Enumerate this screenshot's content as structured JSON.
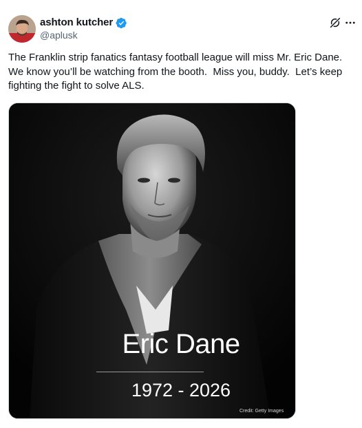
{
  "author": {
    "display_name": "ashton kutcher",
    "handle": "@aplusk",
    "verified": true,
    "avatar": "avatar-photo"
  },
  "header_icons": [
    "grok-icon",
    "more-options-icon"
  ],
  "tweet": {
    "text": "The Franklin strip fanatics fantasy football league will miss Mr. Eric Dane.\nWe know you’ll be watching from the booth.  Miss you, buddy.  Let’s keep\nfighting the fight to solve ALS."
  },
  "media": {
    "type": "photo",
    "overlay_name": "Eric Dane",
    "overlay_years": "1972 - 2026",
    "credit": "Credit: Getty Images"
  },
  "colors": {
    "text_primary": "#0f1419",
    "text_secondary": "#536471",
    "verified_blue": "#1d9bf0",
    "media_background": "#050505"
  }
}
